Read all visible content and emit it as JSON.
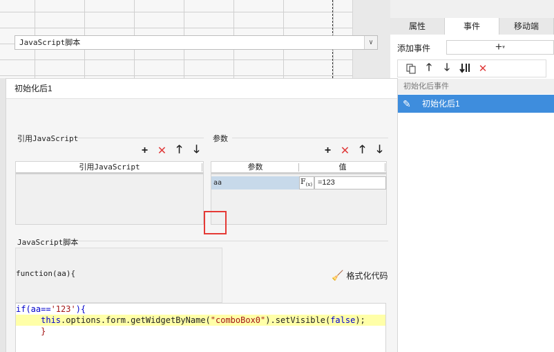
{
  "right_panel": {
    "tabs": [
      "属性",
      "事件",
      "移动端"
    ],
    "add_event_label": "添加事件",
    "add_event_symbol": "+",
    "event_section_label": "初始化后事件",
    "event_item_label": "初始化后1"
  },
  "dialog": {
    "title": "初始化后1",
    "type_select_value": "JavaScript脚本",
    "ref_section_label": "引用JavaScript",
    "ref_table_header": "引用JavaScript",
    "param_section_label": "参数",
    "param_columns": [
      "参数",
      "值"
    ],
    "param_row": {
      "name": "aa",
      "fx": "F",
      "fx_sub": "(x)",
      "value": "=123"
    },
    "script_section_label": "JavaScript脚本",
    "function_signature": "function(aa){",
    "format_button_label": "格式化代码",
    "code": {
      "line1_kw": "if",
      "line1_mid": "(aa==",
      "line1_str": "'123'",
      "line1_end": "){",
      "line2_this": "this",
      "line2_mid": ".options.form.getWidgetByName(",
      "line2_str": "\"comboBox0\"",
      "line2_mid2": ").setVisible(",
      "line2_kw": "false",
      "line2_end": ");",
      "line3": "}"
    }
  },
  "colors": {
    "accent": "#3e8ddd",
    "delete_red": "#e03a3a",
    "highlight_line": "#ffffa8",
    "marker_red": "#e53935"
  },
  "icons": [
    "paste-icon",
    "up-arrow-icon",
    "down-arrow-icon",
    "move-bottom-icon",
    "delete-icon",
    "add-icon",
    "edit-pen-icon",
    "broom-icon",
    "dropdown-arrow-icon",
    "formula-icon"
  ]
}
